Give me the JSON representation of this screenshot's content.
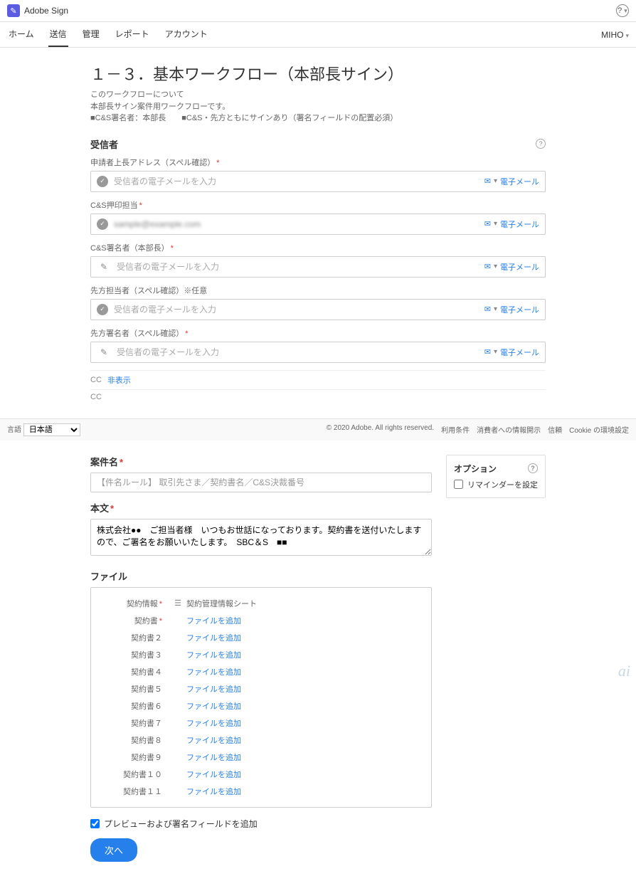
{
  "header": {
    "logo_glyph": "✎",
    "product": "Adobe Sign",
    "help_glyph": "?",
    "user": "MIHO"
  },
  "tabs": [
    "ホーム",
    "送信",
    "管理",
    "レポート",
    "アカウント"
  ],
  "active_tab_index": 1,
  "workflow": {
    "title": "１－３．基本ワークフロー（本部長サイン）",
    "desc1": "このワークフローについて",
    "desc2": "本部長サイン案件用ワークフローです。",
    "desc3": "■C&S署名者：本部長　　■C&S・先方ともにサインあり（署名フィールドの配置必須）"
  },
  "recipients": {
    "title": "受信者",
    "info_glyph": "?",
    "email_type": "電子メール",
    "placeholder": "受信者の電子メールを入力",
    "fields": [
      {
        "label": "申請者上長アドレス（スペル確認）",
        "required": true,
        "icon": "check",
        "value": "",
        "blurred": false
      },
      {
        "label": "C&S押印担当",
        "required": true,
        "icon": "check",
        "value": "sample@example.com",
        "blurred": true
      },
      {
        "label": "C&S署名者（本部長）",
        "required": true,
        "icon": "pen",
        "value": "",
        "blurred": false
      },
      {
        "label": "先方担当者（スペル確認）※任意",
        "required": false,
        "icon": "check",
        "value": "",
        "blurred": false
      },
      {
        "label": "先方署名者（スペル確認）",
        "required": true,
        "icon": "pen",
        "value": "",
        "blurred": false
      }
    ],
    "cc_label": "CC",
    "cc_toggle": "非表示",
    "cc2": "CC"
  },
  "footer": {
    "lang_label": "言語",
    "lang_value": "日本語",
    "copyright": "© 2020 Adobe. All rights reserved.",
    "links": [
      "利用条件",
      "消費者への情報開示",
      "信頼",
      "Cookie の環境設定"
    ]
  },
  "form": {
    "subject_label": "案件名",
    "subject_placeholder": "【件名ルール】 取引先さま／契約書名／C&S決裁番号",
    "body_label": "本文",
    "body_value": "株式会社●●　ご担当者様　いつもお世話になっております。契約書を送付いたしますので、ご署名をお願いいたします。　SBC＆S　■■",
    "files_label": "ファイル",
    "files_header": {
      "name": "契約情報",
      "info_label": "契約管理情報シート"
    },
    "files": [
      {
        "name": "契約書",
        "required": true,
        "action": "ファイルを追加"
      },
      {
        "name": "契約書２",
        "required": false,
        "action": "ファイルを追加"
      },
      {
        "name": "契約書３",
        "required": false,
        "action": "ファイルを追加"
      },
      {
        "name": "契約書４",
        "required": false,
        "action": "ファイルを追加"
      },
      {
        "name": "契約書５",
        "required": false,
        "action": "ファイルを追加"
      },
      {
        "name": "契約書６",
        "required": false,
        "action": "ファイルを追加"
      },
      {
        "name": "契約書７",
        "required": false,
        "action": "ファイルを追加"
      },
      {
        "name": "契約書８",
        "required": false,
        "action": "ファイルを追加"
      },
      {
        "name": "契約書９",
        "required": false,
        "action": "ファイルを追加"
      },
      {
        "name": "契約書１０",
        "required": false,
        "action": "ファイルを追加"
      },
      {
        "name": "契約書１１",
        "required": false,
        "action": "ファイルを追加"
      }
    ],
    "options_title": "オプション",
    "reminder_label": "リマインダーを設定",
    "preview_label": "プレビューおよび署名フィールドを追加",
    "next_button": "次へ"
  },
  "watermark": "ai"
}
